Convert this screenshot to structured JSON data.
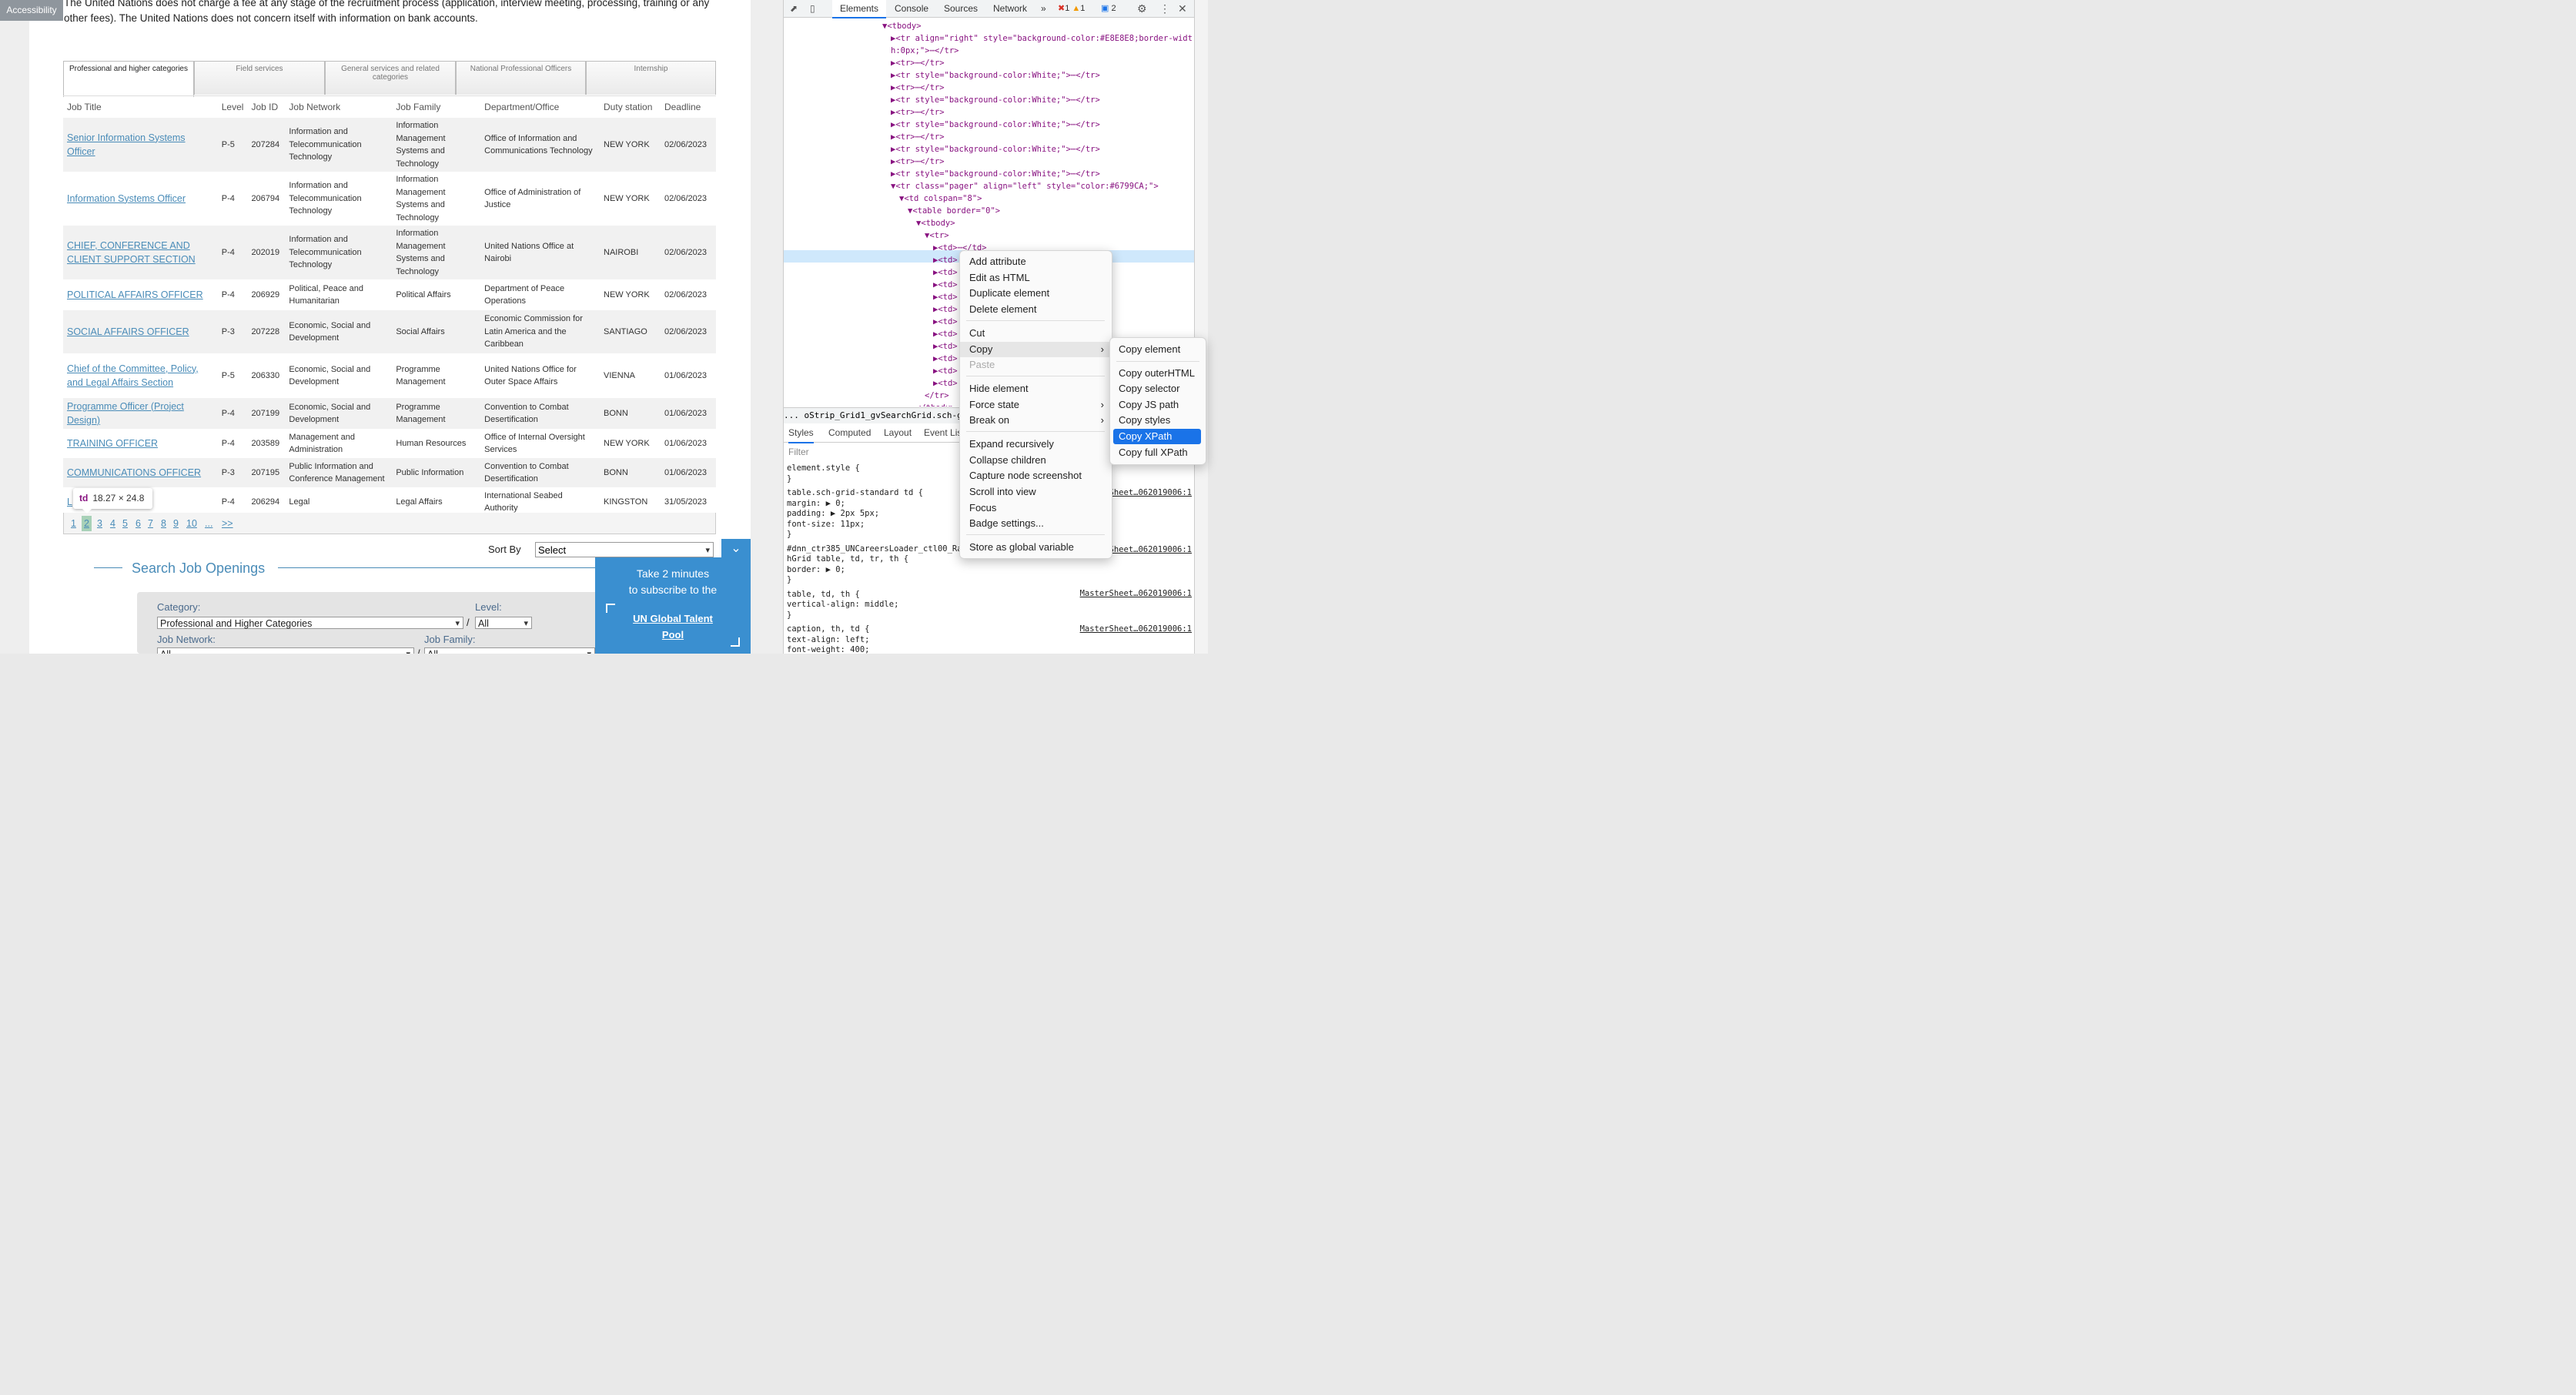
{
  "accessibility_label": "Accessibility",
  "notice": "The United Nations does not charge a fee at any stage of the recruitment process (application, interview meeting, processing, training or any other fees). The United Nations does not concern itself with information on bank accounts.",
  "tabs": [
    "Professional and higher categories",
    "Field services",
    "General services and related categories",
    "National Professional Officers",
    "Internship"
  ],
  "table": {
    "headers": [
      "Job Title",
      "Level",
      "Job ID",
      "Job Network",
      "Job Family",
      "Department/Office",
      "Duty station",
      "Deadline"
    ],
    "rows": [
      {
        "title": "Senior Information Systems Officer",
        "level": "P-5",
        "id": "207284",
        "network": "Information and Telecommunication Technology",
        "family": "Information Management Systems and Technology",
        "dept": "Office of Information and Communications Technology",
        "duty": "NEW YORK",
        "deadline": "02/06/2023"
      },
      {
        "title": "Information Systems Officer",
        "level": "P-4",
        "id": "206794",
        "network": "Information and Telecommunication Technology",
        "family": "Information Management Systems and Technology",
        "dept": "Office of Administration of Justice",
        "duty": "NEW YORK",
        "deadline": "02/06/2023"
      },
      {
        "title": "CHIEF, CONFERENCE AND CLIENT SUPPORT SECTION",
        "level": "P-4",
        "id": "202019",
        "network": "Information and Telecommunication Technology",
        "family": "Information Management Systems and Technology",
        "dept": "United Nations Office at Nairobi",
        "duty": "NAIROBI",
        "deadline": "02/06/2023"
      },
      {
        "title": "POLITICAL AFFAIRS OFFICER",
        "level": "P-4",
        "id": "206929",
        "network": "Political, Peace and Humanitarian",
        "family": "Political Affairs",
        "dept": "Department of Peace Operations",
        "duty": "NEW YORK",
        "deadline": "02/06/2023"
      },
      {
        "title": "SOCIAL AFFAIRS OFFICER",
        "level": "P-3",
        "id": "207228",
        "network": "Economic, Social and Development",
        "family": "Social Affairs",
        "dept": "Economic Commission for Latin America and the Caribbean",
        "duty": "SANTIAGO",
        "deadline": "02/06/2023"
      },
      {
        "title": "Chief of the Committee, Policy, and Legal Affairs Section",
        "level": "P-5",
        "id": "206330",
        "network": "Economic, Social and Development",
        "family": "Programme Management",
        "dept": "United Nations Office for Outer Space Affairs",
        "duty": "VIENNA",
        "deadline": "01/06/2023"
      },
      {
        "title": "Programme Officer (Project Design)",
        "level": "P-4",
        "id": "207199",
        "network": "Economic, Social and Development",
        "family": "Programme Management",
        "dept": "Convention to Combat Desertification",
        "duty": "BONN",
        "deadline": "01/06/2023"
      },
      {
        "title": "TRAINING OFFICER",
        "level": "P-4",
        "id": "203589",
        "network": "Management and Administration",
        "family": "Human Resources",
        "dept": "Office of Internal Oversight Services",
        "duty": "NEW YORK",
        "deadline": "01/06/2023"
      },
      {
        "title": "COMMUNICATIONS OFFICER",
        "level": "P-3",
        "id": "207195",
        "network": "Public Information and Conference Management",
        "family": "Public Information",
        "dept": "Convention to Combat Desertification",
        "duty": "BONN",
        "deadline": "01/06/2023"
      },
      {
        "title": "L",
        "level": "P-4",
        "id": "206294",
        "network": "Legal",
        "family": "Legal Affairs",
        "dept": "International Seabed Authority",
        "duty": "KINGSTON",
        "deadline": "31/05/2023"
      }
    ]
  },
  "pager": [
    "1",
    "2",
    "3",
    "4",
    "5",
    "6",
    "7",
    "8",
    "9",
    "10",
    "...",
    ">>"
  ],
  "tooltip": {
    "tag": "td",
    "size": "18.27 × 24.8"
  },
  "sort": {
    "label": "Sort By",
    "value": "Select"
  },
  "search": {
    "title": "Search Job Openings",
    "category_label": "Category:",
    "category_value": "Professional and Higher Categories",
    "level_label": "Level:",
    "level_value": "All",
    "network_label": "Job Network:",
    "family_label": "Job Family:",
    "network_value": "All",
    "family_value": "All"
  },
  "promo": {
    "line1": "Take 2 minutes",
    "line2": "to subscribe to the",
    "link": "UN Global Talent Pool"
  },
  "devtools": {
    "tabs": [
      "Elements",
      "Console",
      "Sources",
      "Network",
      "»"
    ],
    "errors": "1",
    "warnings": "1",
    "messages": "2",
    "breadcrumb": "...  oStrip_Grid1_gvSearchGrid.sch-grid-sta",
    "style_tabs": [
      "Styles",
      "Computed",
      "Layout",
      "Event Lis"
    ],
    "filter": "Filter",
    "lines": [
      {
        "indent": 0,
        "text": "▼<tbody>"
      },
      {
        "indent": 1,
        "text": "▶<tr align=\"right\" style=\"background-color:#E8E8E8;border-widt"
      },
      {
        "indent": 1,
        "text": "h:0px;\">⋯</tr>"
      },
      {
        "indent": 1,
        "text": "▶<tr>⋯</tr>"
      },
      {
        "indent": 1,
        "text": "▶<tr style=\"background-color:White;\">⋯</tr>"
      },
      {
        "indent": 1,
        "text": "▶<tr>⋯</tr>"
      },
      {
        "indent": 1,
        "text": "▶<tr style=\"background-color:White;\">⋯</tr>"
      },
      {
        "indent": 1,
        "text": "▶<tr>⋯</tr>"
      },
      {
        "indent": 1,
        "text": "▶<tr style=\"background-color:White;\">⋯</tr>"
      },
      {
        "indent": 1,
        "text": "▶<tr>⋯</tr>"
      },
      {
        "indent": 1,
        "text": "▶<tr style=\"background-color:White;\">⋯</tr>"
      },
      {
        "indent": 1,
        "text": "▶<tr>⋯</tr>"
      },
      {
        "indent": 1,
        "text": "▶<tr style=\"background-color:White;\">⋯</tr>"
      },
      {
        "indent": 1,
        "text": "▼<tr class=\"pager\" align=\"left\" style=\"color:#6799CA;\">"
      },
      {
        "indent": 2,
        "text": "▼<td colspan=\"8\">"
      },
      {
        "indent": 3,
        "text": "▼<table border=\"0\">"
      },
      {
        "indent": 4,
        "text": "▼<tbody>"
      },
      {
        "indent": 5,
        "text": "▼<tr>"
      },
      {
        "indent": 6,
        "text": "▶<td>⋯</td>"
      },
      {
        "indent": 6,
        "text": "▶<td>"
      },
      {
        "indent": 6,
        "text": "▶<td>"
      },
      {
        "indent": 6,
        "text": "▶<td>"
      },
      {
        "indent": 6,
        "text": "▶<td>"
      },
      {
        "indent": 6,
        "text": "▶<td>"
      },
      {
        "indent": 6,
        "text": "▶<td>"
      },
      {
        "indent": 6,
        "text": "▶<td>"
      },
      {
        "indent": 6,
        "text": "▶<td>"
      },
      {
        "indent": 6,
        "text": "▶<td>"
      },
      {
        "indent": 6,
        "text": "▶<td>"
      },
      {
        "indent": 6,
        "text": "▶<td>"
      },
      {
        "indent": 5,
        "text": "</tr>"
      },
      {
        "indent": 4,
        "text": "</tbody>"
      }
    ],
    "rules": [
      "element.style {",
      "}",
      "table.sch-grid-standard td {",
      "    margin: ▶ 0;",
      "    padding: ▶ 2px 5px;",
      "    font-size: 11px;",
      "}",
      "#dnn_ctr385_UNCareersLoader_ctl00_Ra",
      "hGrid table, td, tr, th {",
      "    border: ▶ 0;",
      "}",
      "table, td, th {",
      "    vertical-align: middle;",
      "}",
      "caption, th, td {",
      "    text-align: left;",
      "    font-weight: 400;"
    ],
    "sources": [
      "Sheet…062019006:1",
      "Sheet…062019006:1",
      "MasterSheet…062019006:1",
      "MasterSheet…062019006:1"
    ]
  },
  "context_menu": {
    "items": [
      "Add attribute",
      "Edit as HTML",
      "Duplicate element",
      "Delete element",
      "Cut",
      "Copy",
      "Paste",
      "Hide element",
      "Force state",
      "Break on",
      "Expand recursively",
      "Collapse children",
      "Capture node screenshot",
      "Scroll into view",
      "Focus",
      "Badge settings...",
      "Store as global variable"
    ],
    "submenu": [
      "Copy element",
      "Copy outerHTML",
      "Copy selector",
      "Copy JS path",
      "Copy styles",
      "Copy XPath",
      "Copy full XPath"
    ]
  }
}
